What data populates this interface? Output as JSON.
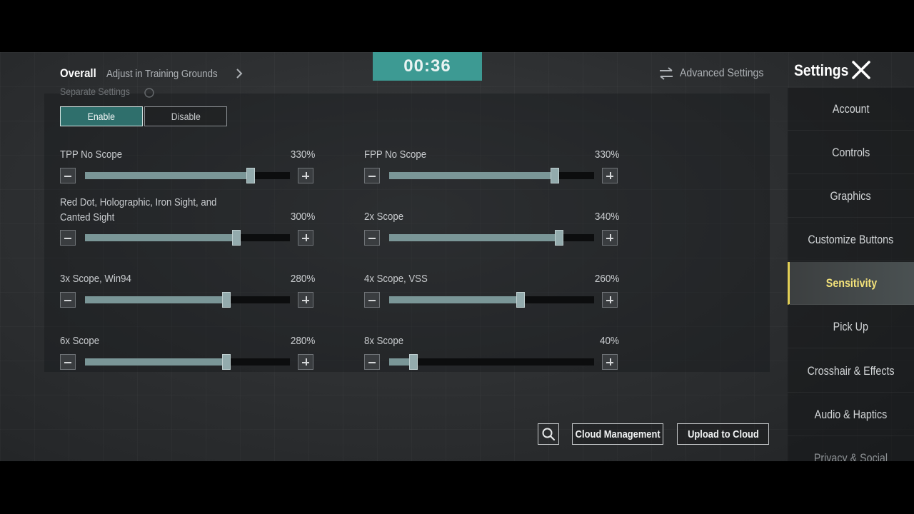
{
  "header": {
    "tab_overall": "Overall",
    "tab_training": "Adjust in Training Grounds",
    "timer": "00:36",
    "advanced_settings": "Advanced Settings",
    "settings_title": "Settings"
  },
  "separate_settings": {
    "label": "Separate Settings",
    "enable": "Enable",
    "disable": "Disable",
    "selected": "Enable"
  },
  "sliders": [
    {
      "label": "TPP No Scope",
      "value": "330%",
      "level": 0.81
    },
    {
      "label": "FPP No Scope",
      "value": "330%",
      "level": 0.81
    },
    {
      "label": "Red Dot, Holographic, Iron Sight, and Canted Sight",
      "value": "300%",
      "level": 0.74
    },
    {
      "label": "2x Scope",
      "value": "340%",
      "level": 0.83
    },
    {
      "label": "3x Scope, Win94",
      "value": "280%",
      "level": 0.69
    },
    {
      "label": "4x Scope, VSS",
      "value": "260%",
      "level": 0.64
    },
    {
      "label": "6x Scope",
      "value": "280%",
      "level": 0.69
    },
    {
      "label": "8x Scope",
      "value": "40%",
      "level": 0.12
    }
  ],
  "bottom": {
    "cloud_management": "Cloud Management",
    "upload_to_cloud": "Upload to Cloud"
  },
  "sidebar": {
    "items": [
      {
        "label": "Account"
      },
      {
        "label": "Controls"
      },
      {
        "label": "Graphics"
      },
      {
        "label": "Customize Buttons"
      },
      {
        "label": "Sensitivity"
      },
      {
        "label": "Pick Up"
      },
      {
        "label": "Crosshair & Effects"
      },
      {
        "label": "Audio & Haptics"
      },
      {
        "label": "Privacy & Social"
      }
    ],
    "active": "Sensitivity"
  },
  "colors": {
    "accent_teal": "#3d9a93",
    "active_text": "#f3e27a",
    "slider_fill": "#7a9697"
  }
}
